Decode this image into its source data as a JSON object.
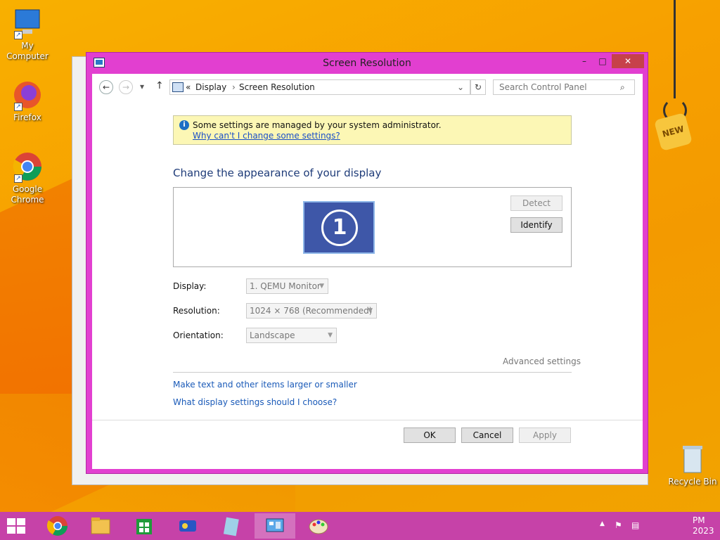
{
  "desktop": {
    "icons": [
      {
        "label": "My Computer"
      },
      {
        "label": "Firefox"
      },
      {
        "label": "Google Chrome"
      },
      {
        "label": "Recycle Bin"
      }
    ],
    "new_tag": "NEW"
  },
  "window": {
    "title": "Screen Resolution",
    "controls": {
      "minimize": "–",
      "maximize": "□",
      "close": "✕"
    },
    "nav": {
      "back": "←",
      "forward": "→",
      "up": "↑",
      "dropdown": "▾"
    },
    "address": {
      "prefix": "«",
      "crumb1": "Display",
      "sep": "›",
      "crumb2": "Screen Resolution",
      "dropdown": "⌄",
      "refresh": "↻"
    },
    "search": {
      "placeholder": "Search Control Panel",
      "icon": "⌕"
    },
    "info": {
      "icon": "i",
      "message": "Some settings are managed by your system administrator.",
      "link": "Why can't I change some settings?"
    },
    "heading": "Change the appearance of your display",
    "monitor_number": "1",
    "detect_label": "Detect",
    "identify_label": "Identify",
    "display": {
      "label": "Display:",
      "value": "1. QEMU Monitor"
    },
    "resolution": {
      "label": "Resolution:",
      "value": "1024 × 768 (Recommended)"
    },
    "orientation": {
      "label": "Orientation:",
      "value": "Landscape"
    },
    "advanced": "Advanced settings",
    "link1": "Make text and other items larger or smaller",
    "link2": "What display settings should I choose?",
    "ok": "OK",
    "cancel": "Cancel",
    "apply": "Apply"
  },
  "taskbar": {
    "clock_time": "PM",
    "clock_year": "2023",
    "tray_arrow": "▲"
  },
  "colors": {
    "accent": "#e23fd0",
    "taskbar": "#c642a8",
    "link": "#1a5ab8"
  }
}
